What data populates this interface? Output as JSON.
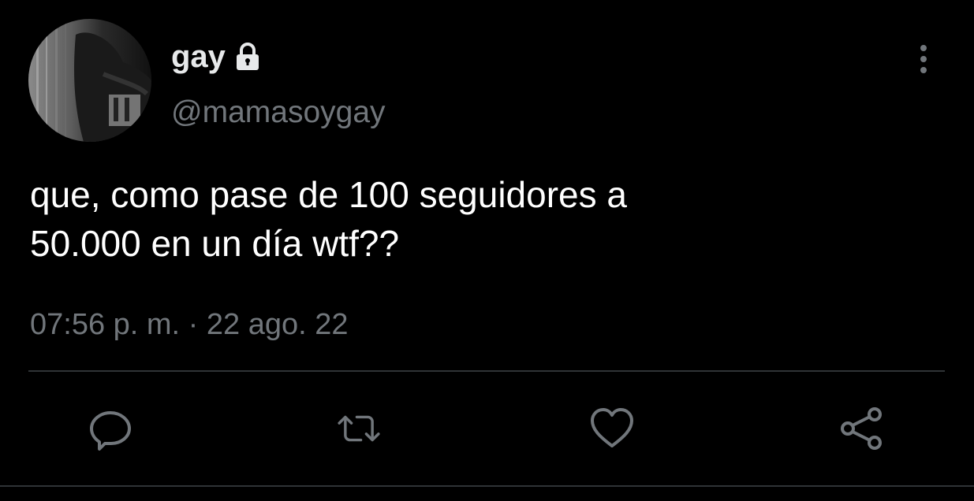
{
  "user": {
    "display_name": "gay",
    "handle": "@mamasoygay",
    "protected_icon": "lock-icon",
    "avatar": "profile-photo"
  },
  "tweet": {
    "text": "que, como pase de 100 seguidores a\n50.000 en un día wtf??",
    "time": "07:56 p. m.",
    "separator": " · ",
    "date": "22 ago. 22"
  },
  "actions": {
    "reply_icon": "comment-icon",
    "retweet_icon": "retweet-icon",
    "like_icon": "heart-icon",
    "share_icon": "share-icon"
  },
  "menu_icon": "more-vertical-icon",
  "colors": {
    "background": "#000000",
    "primary_text": "#e7e9ea",
    "secondary_text": "#71767b",
    "divider": "#2f3336"
  }
}
